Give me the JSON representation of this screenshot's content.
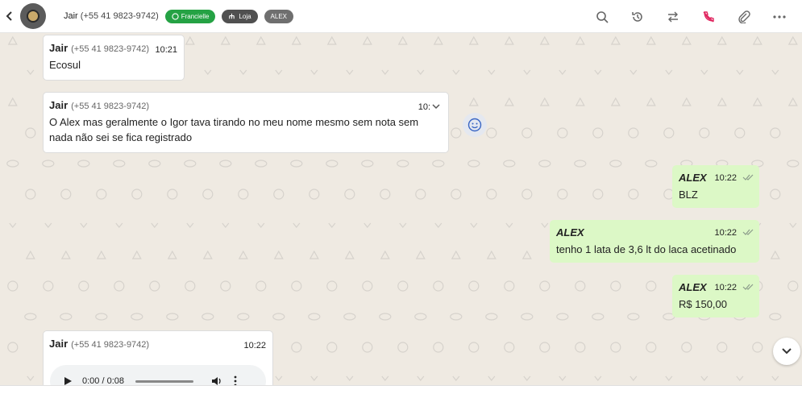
{
  "header": {
    "contact_name": "Jair",
    "contact_phone": "(+55 41 9823-9742)",
    "badges": {
      "whatsapp": "Francielle",
      "store": "Loja",
      "agent": "ALEX"
    },
    "icons": [
      "chevron-left-icon",
      "search-icon",
      "history-icon",
      "transfer-icon",
      "end-call-icon",
      "paperclip-icon",
      "more-icon"
    ],
    "colors": {
      "badge_green": "#25a244",
      "end_call_red": "#e0245e"
    }
  },
  "messages": [
    {
      "sender": "Jair",
      "phone": "(+55 41 9823-9742)",
      "time": "10:21",
      "text": "Ecosul"
    },
    {
      "sender": "Jair",
      "phone": "(+55 41 9823-9742)",
      "time": "10:",
      "text": "O Alex mas geralmente o Igor tava tirando no meu nome mesmo sem nota sem nada não sei se fica registrado"
    },
    {
      "sender": "ALEX",
      "time": "10:22",
      "text": "BLZ"
    },
    {
      "sender": "ALEX",
      "time": "10:22",
      "text": "tenho 1 lata de 3,6 lt do laca acetinado"
    },
    {
      "sender": "ALEX",
      "time": "10:22",
      "text": "R$ 150,00"
    },
    {
      "sender": "Jair",
      "phone": "(+55 41 9823-9742)",
      "time": "10:22",
      "audio": {
        "progress": "0:00 / 0:08"
      }
    }
  ],
  "colors": {
    "outgoing_bubble": "#dcf8c6",
    "incoming_bubble": "#ffffff",
    "chat_bg": "#efeae2"
  }
}
